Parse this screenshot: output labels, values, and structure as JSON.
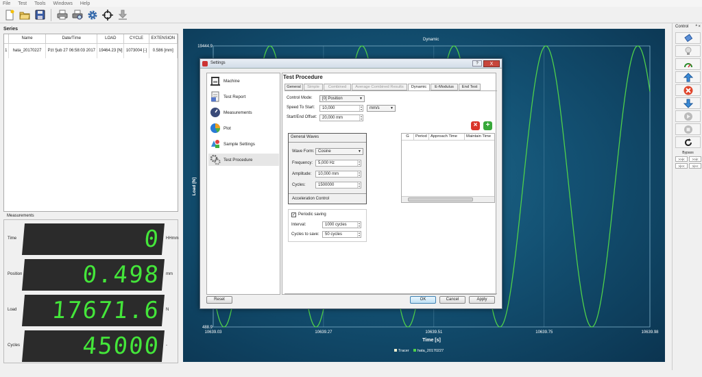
{
  "menu": {
    "items": [
      "File",
      "Test",
      "Tools",
      "Windows",
      "Help"
    ]
  },
  "toolbar": {
    "icons": [
      "new-file-icon",
      "open-folder-icon",
      "save-icon",
      "print-icon",
      "print-preview-icon",
      "settings-gear-icon",
      "crosshair-target-icon",
      "download-arrow-icon"
    ]
  },
  "series": {
    "title": "Series",
    "columns": [
      "Name",
      "Date/Time",
      "LOAD",
      "CYCLE",
      "EXTENSION"
    ],
    "rows": [
      {
        "index": "1",
        "name": "hata_20170227",
        "datetime": "Pzt Şub 27 06:58:03 2017",
        "load": "19464.23 [N]",
        "cycle": "1073004 [-]",
        "extension": "0.586 [mm]"
      }
    ]
  },
  "measurements": {
    "title": "Measurements",
    "items": [
      {
        "label": "Time",
        "value": "0",
        "unit": "HHmm"
      },
      {
        "label": "Position",
        "value": "0.498",
        "unit": "mm"
      },
      {
        "label": "Load",
        "value": "17671.6",
        "unit": "N"
      },
      {
        "label": "Cycles",
        "value": "45000",
        "unit": "-"
      }
    ]
  },
  "control_panel": {
    "title": "Control",
    "bypass_label": "Bypass",
    "bypass_buttons": [
      ">>|<",
      ">>|<",
      ">|<<",
      ">|<<"
    ]
  },
  "chart_data": {
    "type": "line",
    "title": "Dynamic",
    "xlabel": "Time [s]",
    "ylabel": "Load [N]",
    "xlim": [
      10639.03,
      10639.98
    ],
    "ylim": [
      488.9,
      19444.9
    ],
    "x_ticks": [
      "10639.03",
      "10639.27",
      "10639.51",
      "10639.75",
      "10639.98"
    ],
    "y_ticks": [
      "19444.9",
      "488.9"
    ],
    "grid": true,
    "legend": {
      "placement": "bottom-center",
      "entries": [
        "Tracer",
        "hata_20170227"
      ]
    },
    "series": [
      {
        "name": "hata_20170227",
        "waveform": "cosine",
        "frequency_hz": 5,
        "min": 488.9,
        "max": 19444.9,
        "color": "#4fd14a"
      }
    ],
    "colors": {
      "line": "#4fd14a",
      "grid": "#7fb0c8",
      "text": "#ffffff"
    }
  },
  "dialog": {
    "title": "Settings",
    "help": "?",
    "close": "X",
    "nav": [
      {
        "label": "Machine",
        "icon": "machine-icon"
      },
      {
        "label": "Test Report",
        "icon": "report-icon"
      },
      {
        "label": "Measurements",
        "icon": "gauge-icon"
      },
      {
        "label": "Plot",
        "icon": "pie-chart-icon"
      },
      {
        "label": "Sample Settings",
        "icon": "sample-shapes-icon"
      },
      {
        "label": "Test Procedure",
        "icon": "gears-icon",
        "selected": true
      }
    ],
    "section_title": "Test Procedure",
    "tabs": [
      {
        "label": "General",
        "state": "normal"
      },
      {
        "label": "Simple",
        "state": "disabled"
      },
      {
        "label": "Combined",
        "state": "disabled"
      },
      {
        "label": "Average Combined Results",
        "state": "disabled"
      },
      {
        "label": "Dynamic",
        "state": "active"
      },
      {
        "label": "E-Modulus",
        "state": "normal"
      },
      {
        "label": "End Test",
        "state": "normal"
      }
    ],
    "control_mode": {
      "label": "Control Mode:",
      "value": "[0] Position"
    },
    "speed_to_start": {
      "label": "Speed To Start:",
      "value": "10,000",
      "unit": "mm/s"
    },
    "start_end_offset": {
      "label": "Start/End Offset:",
      "value": "20,000 mm"
    },
    "general_waves": {
      "title": "General Waves",
      "wave_form": {
        "label": "Wave Form:",
        "value": "Cosine"
      },
      "frequency": {
        "label": "Frequency:",
        "value": "5,000 Hz"
      },
      "amplitude": {
        "label": "Amplitude:",
        "value": "10,000 mm"
      },
      "cycles": {
        "label": "Cycles:",
        "value": "1500000"
      },
      "acceleration": "Acceleration Control"
    },
    "table_columns": [
      "G",
      "Period",
      "Approach Time",
      "Maintain Time"
    ],
    "periodic": {
      "label": "Periodic saving",
      "checked": true,
      "interval": {
        "label": "Interval:",
        "value": "1000 cycles"
      },
      "cycles_to_save": {
        "label": "Cycles to save:",
        "value": "50 cycles"
      }
    },
    "buttons": {
      "reset": "Reset",
      "ok": "OK",
      "cancel": "Cancel",
      "apply": "Apply"
    }
  }
}
